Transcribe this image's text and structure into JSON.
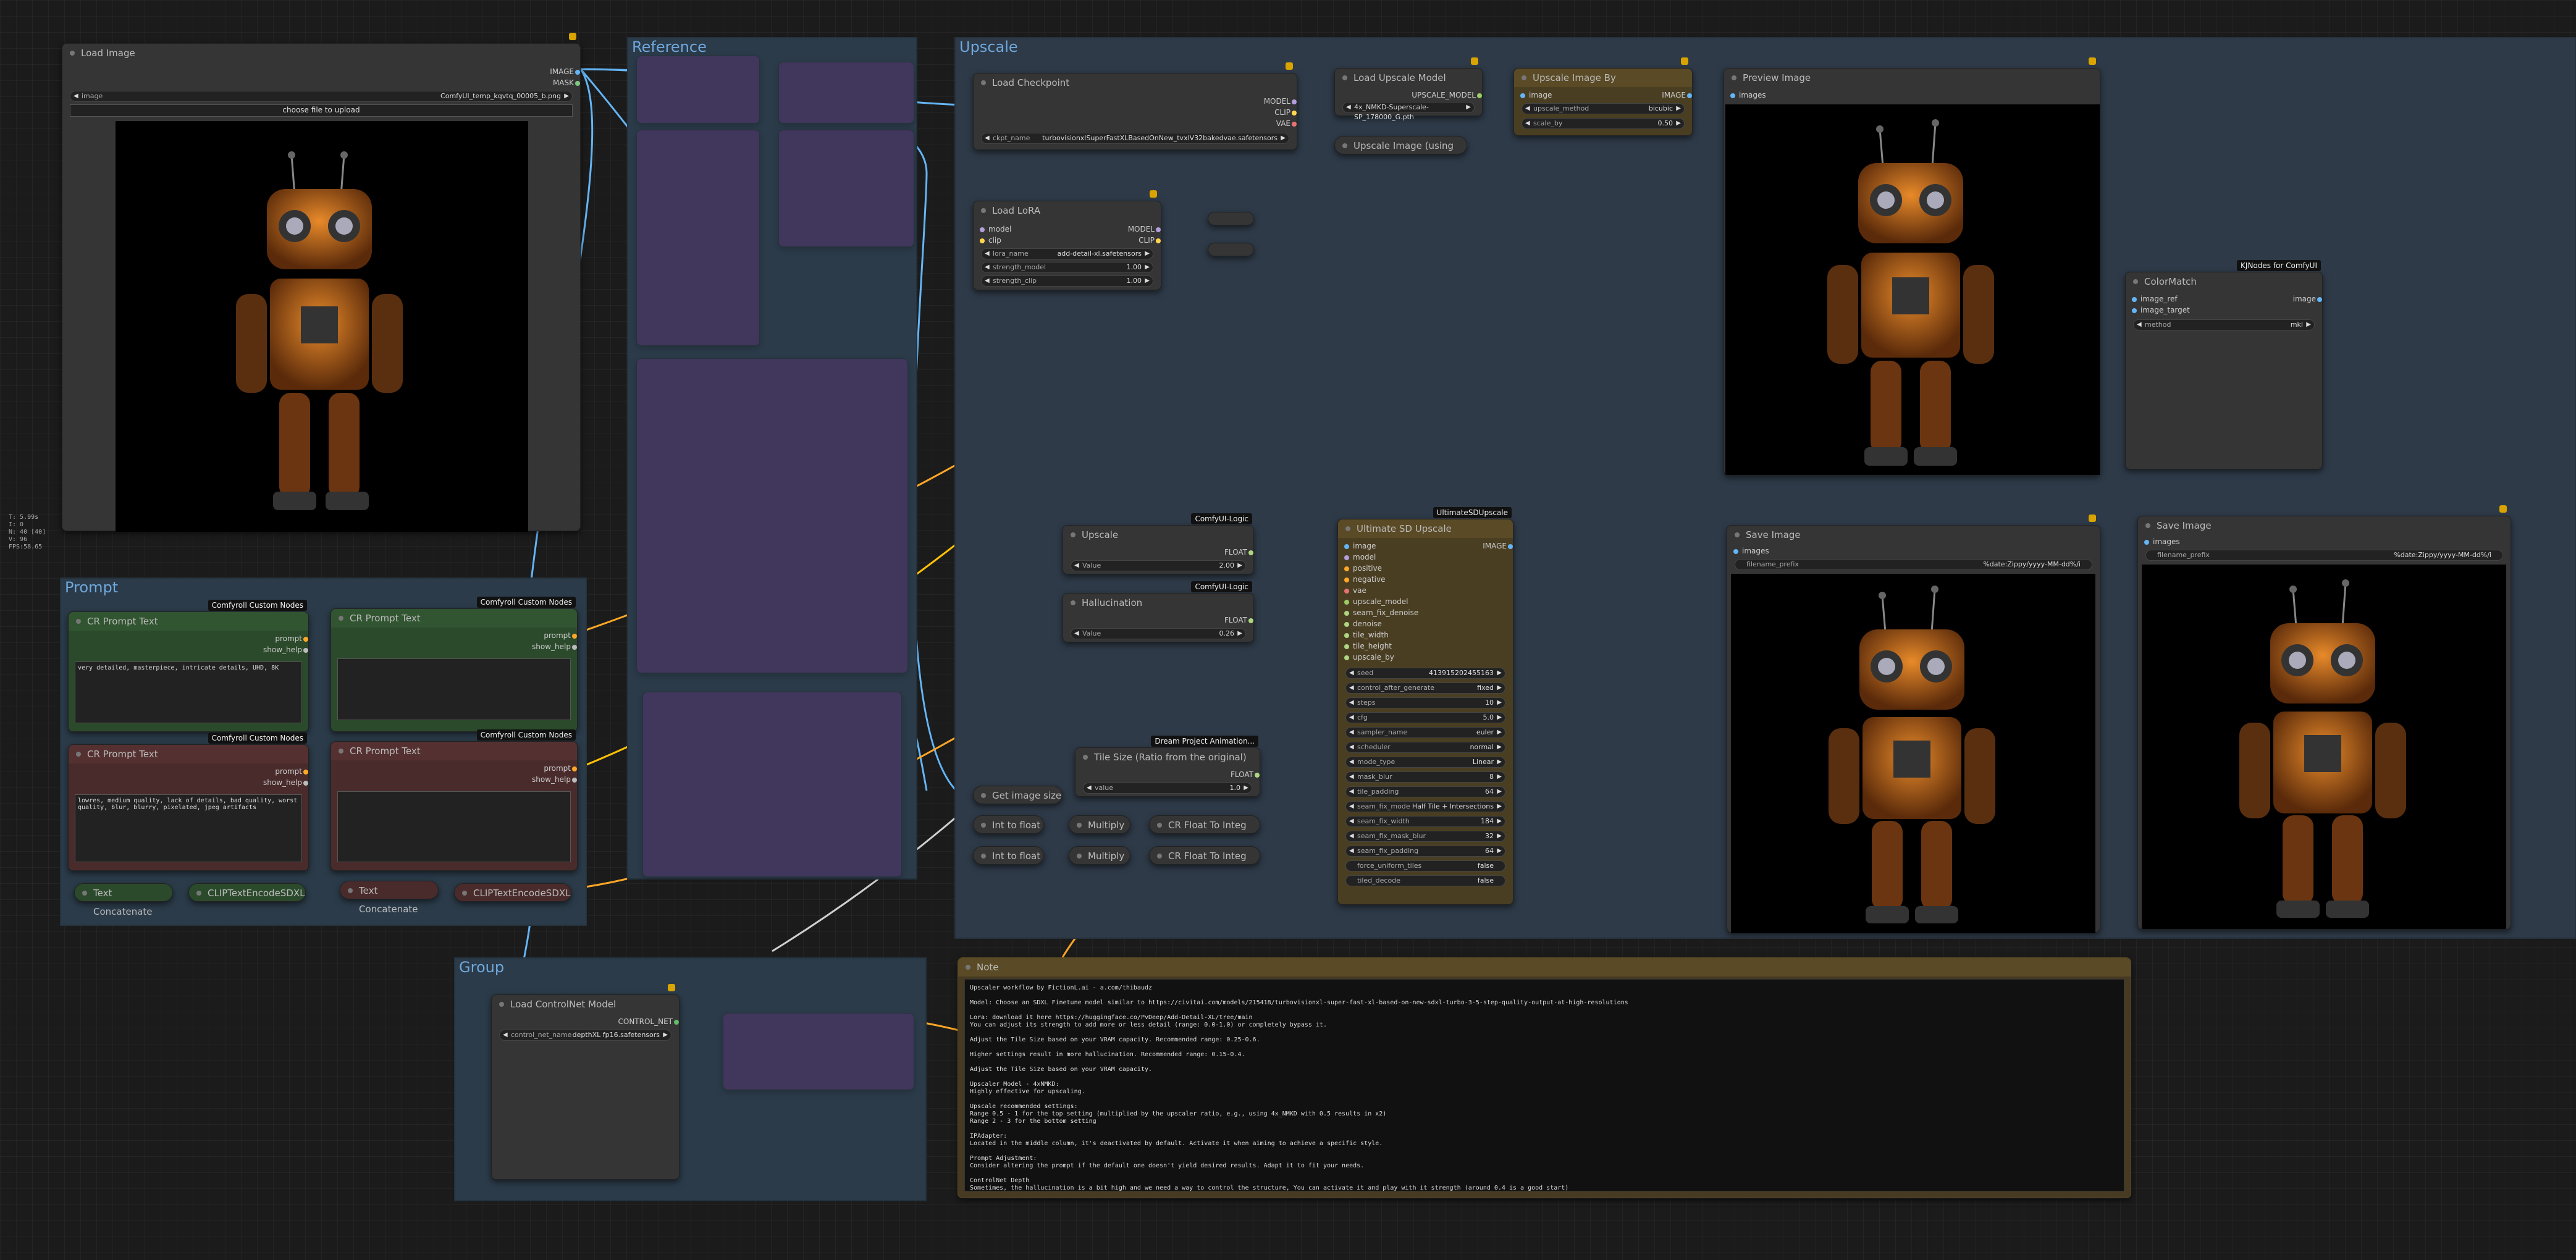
{
  "stats": [
    "T: 5.99s",
    "I: 0",
    "N: 40 [40]",
    "V: 96",
    "FPS:58.65"
  ],
  "groups": {
    "reference": "Reference",
    "upscale": "Upscale",
    "prompt": "Prompt",
    "group": "Group"
  },
  "load_image": {
    "title": "Load Image",
    "out_image": "IMAGE",
    "out_mask": "MASK",
    "image_label": "image",
    "image_value": "ComfyUI_temp_kqvtq_00005_b.png",
    "upload_button": "choose file to upload"
  },
  "load_checkpoint": {
    "title": "Load Checkpoint",
    "out_model": "MODEL",
    "out_clip": "CLIP",
    "out_vae": "VAE",
    "ckpt_label": "ckpt_name",
    "ckpt_value": "turbovisionxlSuperFastXLBasedOnNew_tvxlV32bakedvae.safetensors"
  },
  "load_lora": {
    "title": "Load LoRA",
    "in_model": "model",
    "in_clip": "clip",
    "out_model": "MODEL",
    "out_clip": "CLIP",
    "lora_label": "lora_name",
    "lora_value": "add-detail-xl.safetensors",
    "strength_model_label": "strength_model",
    "strength_model_value": "1.00",
    "strength_clip_label": "strength_clip",
    "strength_clip_value": "1.00"
  },
  "load_upscale_model": {
    "title": "Load Upscale Model",
    "out": "UPSCALE_MODEL",
    "value": "4x_NMKD-Superscale-SP_178000_G.pth"
  },
  "upscale_image_using": {
    "title": "Upscale Image (using"
  },
  "upscale_image_by": {
    "title": "Upscale Image By",
    "in_image": "image",
    "out_image": "IMAGE",
    "method_label": "upscale_method",
    "method_value": "bicubic",
    "scale_label": "scale_by",
    "scale_value": "0.50"
  },
  "preview_image": {
    "title": "Preview Image",
    "in_images": "images"
  },
  "color_match": {
    "title": "ColorMatch",
    "badge": "KJNodes for ComfyUI",
    "in_ref": "image_ref",
    "in_target": "image_target",
    "out_image": "image",
    "method_label": "method",
    "method_value": "mkl"
  },
  "upscale_float": {
    "title": "Upscale",
    "badge": "ComfyUI-Logic",
    "out": "FLOAT",
    "value_label": "Value",
    "value": "2.00"
  },
  "hallucination": {
    "title": "Hallucination",
    "badge": "ComfyUI-Logic",
    "out": "FLOAT",
    "value_label": "Value",
    "value": "0.26"
  },
  "tile_size": {
    "title": "Tile Size (Ratio from the original)",
    "badge": "Dream Project Animation...",
    "out": "FLOAT",
    "value_label": "value",
    "value": "1.0"
  },
  "get_image_size": {
    "title": "Get image size"
  },
  "int_to_float_1": {
    "title": "Int to float"
  },
  "int_to_float_2": {
    "title": "Int to float"
  },
  "multiply_1": {
    "title": "Multiply"
  },
  "multiply_2": {
    "title": "Multiply"
  },
  "cr_float_to_integer_1": {
    "title": "CR Float To Integ"
  },
  "cr_float_to_integer_2": {
    "title": "CR Float To Integ"
  },
  "ultimate_sd_upscale": {
    "title": "Ultimate SD Upscale",
    "badge": "UltimateSDUpscale",
    "out": "IMAGE",
    "inputs": [
      "image",
      "model",
      "positive",
      "negative",
      "vae",
      "upscale_model",
      "seam_fix_denoise",
      "denoise",
      "tile_width",
      "tile_height",
      "upscale_by"
    ],
    "widgets": [
      {
        "label": "seed",
        "value": "413915202455163"
      },
      {
        "label": "control_after_generate",
        "value": "fixed"
      },
      {
        "label": "steps",
        "value": "10"
      },
      {
        "label": "cfg",
        "value": "5.0"
      },
      {
        "label": "sampler_name",
        "value": "euler"
      },
      {
        "label": "scheduler",
        "value": "normal"
      },
      {
        "label": "mode_type",
        "value": "Linear"
      },
      {
        "label": "mask_blur",
        "value": "8"
      },
      {
        "label": "tile_padding",
        "value": "64"
      },
      {
        "label": "seam_fix_mode",
        "value": "Half Tile + Intersections"
      },
      {
        "label": "seam_fix_width",
        "value": "184"
      },
      {
        "label": "seam_fix_mask_blur",
        "value": "32"
      },
      {
        "label": "seam_fix_padding",
        "value": "64"
      },
      {
        "label": "force_uniform_tiles",
        "value": "false"
      },
      {
        "label": "tiled_decode",
        "value": "false"
      }
    ]
  },
  "save_image_1": {
    "title": "Save Image",
    "in_images": "images",
    "prefix_label": "filename_prefix",
    "prefix_value": "%date:Zippy/yyyy-MM-dd%/i"
  },
  "save_image_2": {
    "title": "Save Image",
    "in_images": "images",
    "prefix_label": "filename_prefix",
    "prefix_value": "%date:Zippy/yyyy-MM-dd%/i"
  },
  "cr_prompt_pos_1": {
    "title": "CR Prompt Text",
    "badge": "Comfyroll Custom Nodes",
    "out_prompt": "prompt",
    "out_help": "show_help",
    "text": "very detailed, masterpiece, intricate details, UHD, 8K"
  },
  "cr_prompt_pos_2": {
    "title": "CR Prompt Text",
    "badge": "Comfyroll Custom Nodes",
    "out_prompt": "prompt",
    "out_help": "show_help",
    "text": ""
  },
  "cr_prompt_neg_1": {
    "title": "CR Prompt Text",
    "badge": "Comfyroll Custom Nodes",
    "out_prompt": "prompt",
    "out_help": "show_help",
    "text": "lowres, medium quality, lack of details, bad quality, worst quality, blur, blurry, pixelated, jpeg artifacts"
  },
  "cr_prompt_neg_2": {
    "title": "CR Prompt Text",
    "badge": "Comfyroll Custom Nodes",
    "out_prompt": "prompt",
    "out_help": "show_help",
    "text": ""
  },
  "text_concat_1": {
    "title": "Text Concatenate"
  },
  "text_concat_2": {
    "title": "Text Concatenate"
  },
  "clip_encode_1": {
    "title": "CLIPTextEncodeSDXL"
  },
  "clip_encode_2": {
    "title": "CLIPTextEncodeSDXL"
  },
  "load_controlnet": {
    "title": "Load ControlNet Model",
    "out": "CONTROL_NET",
    "label": "control_net_name",
    "value": "depthXL fp16.safetensors"
  },
  "note": {
    "title": "Note",
    "text": "Upscaler workflow by FictionL.ai - a.com/thibaudz\n\nModel: Choose an SDXL Finetune model similar to https://civitai.com/models/215418/turbovisionxl-super-fast-xl-based-on-new-sdxl-turbo-3-5-step-quality-output-at-high-resolutions\n\nLora: download it here https://huggingface.co/PvDeep/Add-Detail-XL/tree/main\nYou can adjust its strength to add more or less detail (range: 0.0-1.0) or completely bypass it.\n\nAdjust the Tile Size based on your VRAM capacity. Recommended range: 0.25-0.6.\n\nHigher settings result in more hallucination. Recommended range: 0.15-0.4.\n\nAdjust the Tile Size based on your VRAM capacity.\n\nUpscaler Model - 4xNMKD:\nHighly effective for upscaling.\n\nUpscale recommended settings:\nRange 0.5 - 1 for the top setting (multiplied by the upscaler ratio, e.g., using 4x_NMKD with 0.5 results in x2)\nRange 2 - 3 for the bottom setting\n\nIPAdapter:\nLocated in the middle column, it's deactivated by default. Activate it when aiming to achieve a specific style.\n\nPrompt Adjustment:\nConsider altering the prompt if the default one doesn't yield desired results. Adapt it to fit your needs.\n\nControlNet Depth\nSometimes, the hallucination is a bit high and we need a way to control the structure, You can activate it and play with it strength (around 0.4 is a good start)"
  },
  "colors": {
    "upscale_group": "#2e3a48",
    "reference_group": "#2b3b49",
    "prompt_group": "#2b3b49",
    "group_group": "#2b3b49",
    "note_bg": "#463a22",
    "green_node": "#2b4a2b",
    "red_node": "#4a2b2b",
    "purple_node": "#6a2d80",
    "ultimate_node": "#4a3e22"
  }
}
